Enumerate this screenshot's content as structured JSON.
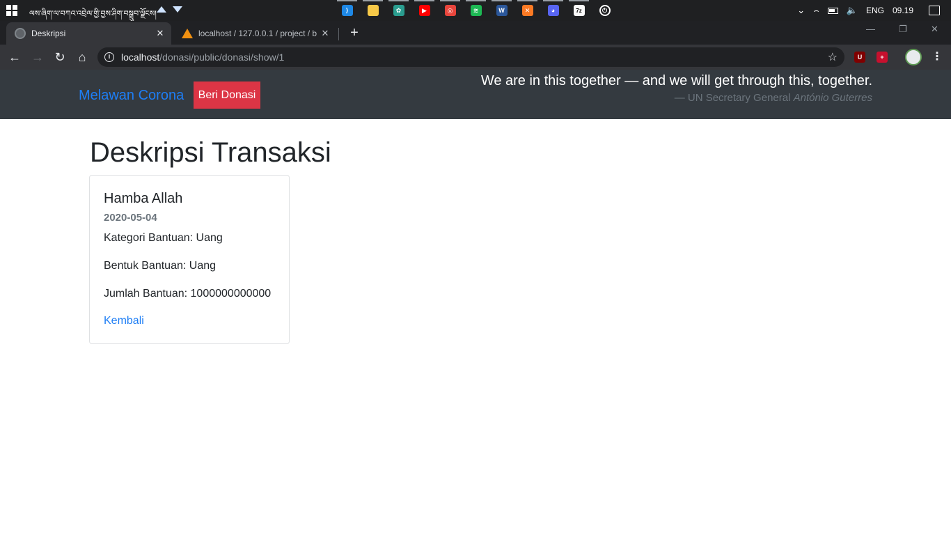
{
  "taskbar": {
    "script_text": "ལས་ཞིག་ལ་བཀའ་འབྲེལ་གྱི་བྱས་ཤིག་བསྒྲུབ་ལྗོངས།",
    "apps": [
      {
        "icon": "vscode-icon",
        "color": "#1e88e5",
        "glyph": "⟩"
      },
      {
        "icon": "file-explorer-icon",
        "color": "#f7c948",
        "glyph": ""
      },
      {
        "icon": "gitkraken-icon",
        "color": "#2a9d8f",
        "glyph": "✿"
      },
      {
        "icon": "youtube-icon",
        "color": "#ff0000",
        "glyph": "▶"
      },
      {
        "icon": "chrome-icon",
        "color": "#e8453c",
        "glyph": "◎"
      },
      {
        "icon": "spotify-icon",
        "color": "#1db954",
        "glyph": "≋"
      },
      {
        "icon": "word-icon",
        "color": "#2b579a",
        "glyph": "W"
      },
      {
        "icon": "xampp-icon",
        "color": "#fb7a24",
        "glyph": "✕"
      },
      {
        "icon": "discord-icon",
        "color": "#5865f2",
        "glyph": "◕"
      },
      {
        "icon": "7zip-icon",
        "color": "#fafafa",
        "glyph": "7z"
      },
      {
        "icon": "power-icon",
        "color": "#1f2022",
        "glyph": "⏻"
      }
    ],
    "language": "ENG",
    "time": "09.19"
  },
  "browser": {
    "tabs": [
      {
        "title": "Deskripsi",
        "active": true
      },
      {
        "title": "localhost / 127.0.0.1 / project / b",
        "active": false
      }
    ],
    "url_host": "localhost",
    "url_path": "/donasi/public/donasi/show/1"
  },
  "site": {
    "brand": "Melawan Corona",
    "donate_button": "Beri Donasi",
    "quote": "We are in this together — and we will get through this, together.",
    "quote_source_prefix": "— UN Secretary General ",
    "quote_source_name": "António Guterres"
  },
  "content": {
    "title": "Deskripsi Transaksi",
    "card": {
      "donor": "Hamba Allah",
      "date": "2020-05-04",
      "lines": [
        "Kategori Bantuan: Uang",
        "Bentuk Bantuan: Uang",
        "Jumlah Bantuan: 1000000000000"
      ],
      "back_link": "Kembali"
    }
  }
}
